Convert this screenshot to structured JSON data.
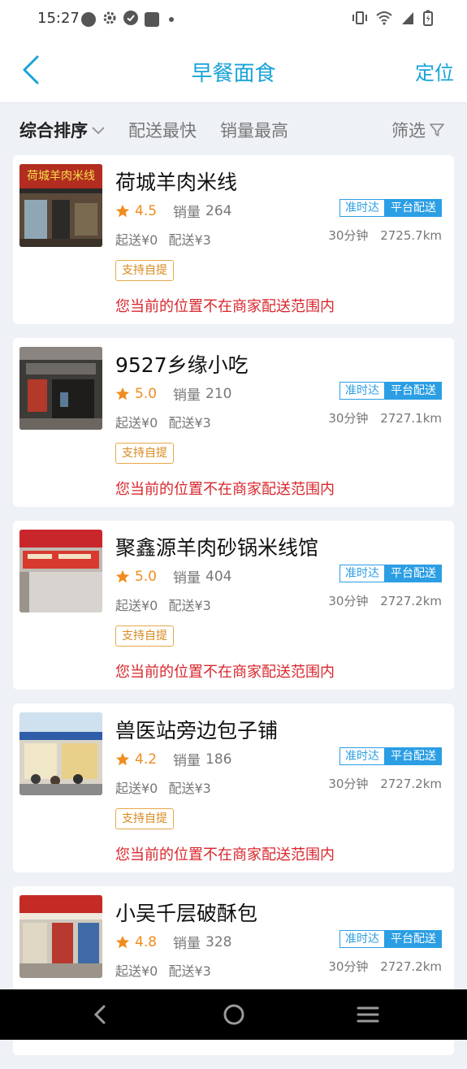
{
  "status_bar": {
    "time": "15:27",
    "left_icons": [
      "message-icon",
      "gear-icon",
      "check-circle-icon",
      "mail-icon",
      "dot-icon"
    ],
    "right_icons": [
      "vibrate-icon",
      "wifi-icon",
      "signal-icon",
      "battery-charging-icon"
    ]
  },
  "header": {
    "title": "早餐面食",
    "locate_label": "定位",
    "accent_color": "#1aa3d8"
  },
  "filters": {
    "sort_label": "综合排序",
    "fastest_label": "配送最快",
    "sales_label": "销量最高",
    "filter_label": "筛选"
  },
  "stores": [
    {
      "name": "荷城羊肉米线",
      "score": "4.5",
      "sales_label": "销量",
      "sales": "264",
      "min_order": "起送¥0",
      "delivery_fee": "配送¥3",
      "tag_ontime": "准时达",
      "tag_platform": "平台配送",
      "time": "30分钟",
      "distance": "2725.7km",
      "pickup": "支持自提",
      "warning": "您当前的位置不在商家配送范围内",
      "thumb_sign_text": "荷城羊肉米线"
    },
    {
      "name": "9527乡缘小吃",
      "score": "5.0",
      "sales_label": "销量",
      "sales": "210",
      "min_order": "起送¥0",
      "delivery_fee": "配送¥3",
      "tag_ontime": "准时达",
      "tag_platform": "平台配送",
      "time": "30分钟",
      "distance": "2727.1km",
      "pickup": "支持自提",
      "warning": "您当前的位置不在商家配送范围内"
    },
    {
      "name": "聚鑫源羊肉砂锅米线馆",
      "score": "5.0",
      "sales_label": "销量",
      "sales": "404",
      "min_order": "起送¥0",
      "delivery_fee": "配送¥3",
      "tag_ontime": "准时达",
      "tag_platform": "平台配送",
      "time": "30分钟",
      "distance": "2727.2km",
      "pickup": "支持自提",
      "warning": "您当前的位置不在商家配送范围内"
    },
    {
      "name": "兽医站旁边包子铺",
      "score": "4.2",
      "sales_label": "销量",
      "sales": "186",
      "min_order": "起送¥0",
      "delivery_fee": "配送¥3",
      "tag_ontime": "准时达",
      "tag_platform": "平台配送",
      "time": "30分钟",
      "distance": "2727.2km",
      "pickup": "支持自提",
      "warning": "您当前的位置不在商家配送范围内"
    },
    {
      "name": "小吴千层破酥包",
      "score": "4.8",
      "sales_label": "销量",
      "sales": "328",
      "min_order": "起送¥0",
      "delivery_fee": "配送¥3",
      "tag_ontime": "准时达",
      "tag_platform": "平台配送",
      "time": "30分钟",
      "distance": "2727.2km"
    }
  ],
  "colors": {
    "rating": "#f08c1e",
    "warning": "#d8262c",
    "tag_blue": "#2b9ee4",
    "pickup_border": "#e7a84b"
  },
  "nav_bar": {
    "icons": [
      "nav-back-icon",
      "nav-home-icon",
      "nav-recents-icon"
    ]
  }
}
